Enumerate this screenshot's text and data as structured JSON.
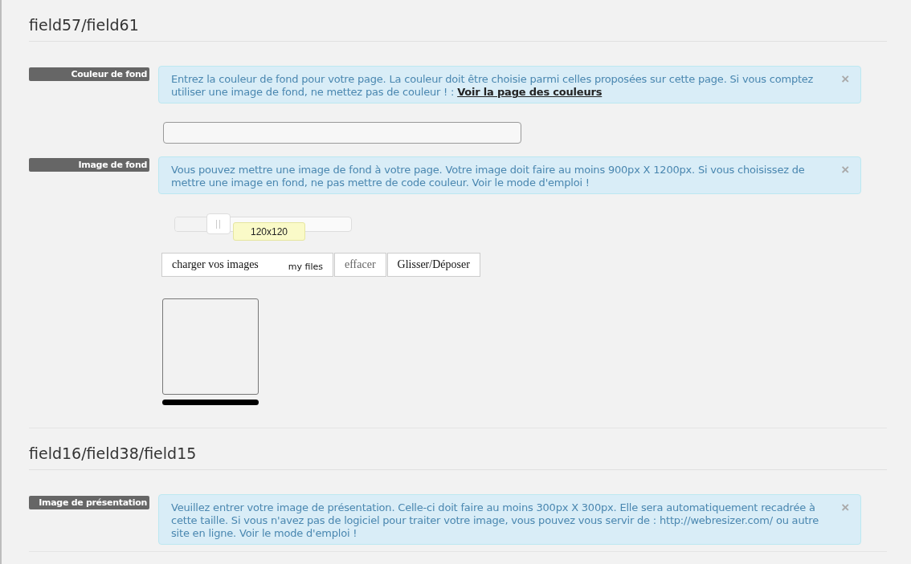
{
  "sections": [
    {
      "title": "field57/field61",
      "fields": [
        {
          "kind": "color",
          "label": "Couleur de fond",
          "help": "Entrez la couleur de fond pour votre page. La couleur doit être choisie parmi celles proposées sur cette page. Si vous comptez utiliser une image de fond, ne mettez pas de couleur ! :",
          "link": "Voir la page des couleurs",
          "close": "×"
        },
        {
          "kind": "image",
          "label": "Image de fond",
          "help": "Vous pouvez mettre une image de fond à votre page. Votre image doit faire au moins 900px X 1200px. Si vous choisissez de mettre une image en fond, ne pas mettre de code couleur. Voir le mode d'emploi !",
          "close": "×",
          "slider": {
            "level": 0.25,
            "tooltip": "120x120"
          },
          "upload": {
            "label": "charger vos images",
            "files": "my files"
          },
          "buttons": [
            "effacer",
            "Glisser/Déposer"
          ],
          "progress": {
            "level": 1
          }
        }
      ]
    },
    {
      "title": "field16/field38/field15",
      "fields": [
        {
          "kind": "info",
          "label": "Image de présentation",
          "help": "Veuillez entrer votre image de présentation. Celle-ci doit faire au moins 300px X 300px. Elle sera automatiquement recadrée à cette taille. Si vous n'avez pas de logiciel pour traiter votre image, vous pouvez vous servir de : http://webresizer.com/ ou autre site en ligne. Voir le mode d'emploi !",
          "close": "×"
        }
      ]
    }
  ]
}
